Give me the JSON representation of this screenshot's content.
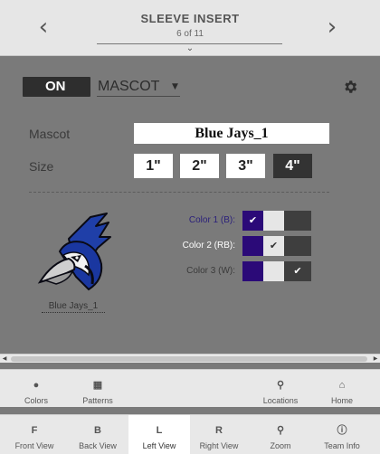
{
  "header": {
    "title": "SLEEVE INSERT",
    "subtitle": "6 of 11",
    "prev_icon": "chevron-left-icon",
    "next_icon": "chevron-right-icon",
    "collapse_icon": "chevron-down-icon"
  },
  "panel": {
    "toggle_label": "ON",
    "type_value": "MASCOT",
    "settings_icon": "gear-icon",
    "mascot_label": "Mascot",
    "mascot_value": "Blue Jays_1",
    "size_label": "Size",
    "sizes": [
      "1\"",
      "2\"",
      "3\"",
      "4\""
    ],
    "selected_size": "4\"",
    "logo_caption": "Blue Jays_1",
    "colors": [
      {
        "label": "Color 1 (B):",
        "label_color": "#2a1f7a",
        "selected": 0
      },
      {
        "label": "Color 2 (RB):",
        "label_color": "#ffffff",
        "selected": 1
      },
      {
        "label": "Color 3 (W):",
        "label_color": "#3a3a3a",
        "selected": 2
      }
    ],
    "swatch_colors": [
      "#2b0a78",
      "#e6e6e6",
      "#3e3e3e"
    ],
    "check_glyph": "✔"
  },
  "toolbar_top": [
    {
      "icon": "drop-icon",
      "glyph": "●",
      "label": "Colors"
    },
    {
      "icon": "grid-icon",
      "glyph": "▦",
      "label": "Patterns"
    },
    {
      "icon": "map-pin-icon",
      "glyph": "⚲",
      "label": "Locations"
    },
    {
      "icon": "home-icon",
      "glyph": "⌂",
      "label": "Home"
    }
  ],
  "toolbar_bottom": [
    {
      "icon": "letter-f-icon",
      "glyph": "F",
      "label": "Front View"
    },
    {
      "icon": "letter-b-icon",
      "glyph": "B",
      "label": "Back View"
    },
    {
      "icon": "letter-l-icon",
      "glyph": "L",
      "label": "Left View",
      "active": true
    },
    {
      "icon": "letter-r-icon",
      "glyph": "R",
      "label": "Right View"
    },
    {
      "icon": "search-icon",
      "glyph": "⚲",
      "label": "Zoom"
    },
    {
      "icon": "info-icon",
      "glyph": "ⓘ",
      "label": "Team Info"
    }
  ]
}
